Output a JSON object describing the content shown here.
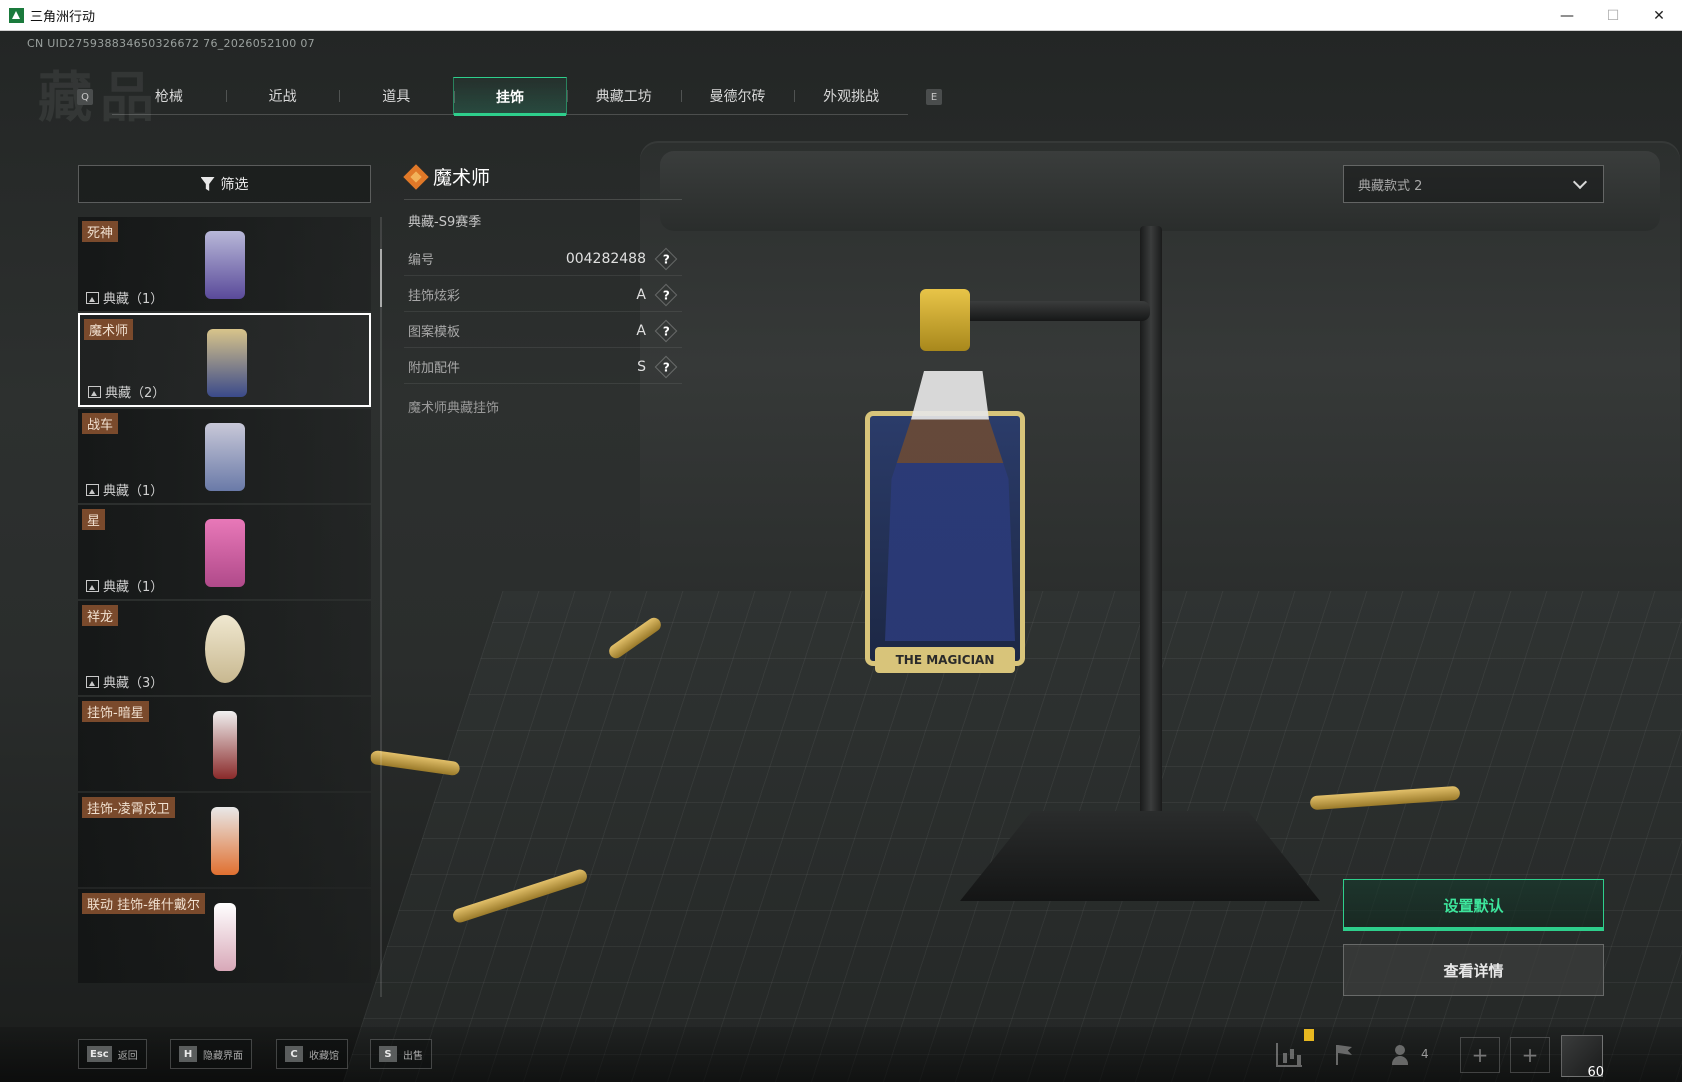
{
  "window": {
    "title": "三角洲行动",
    "controls": [
      "—",
      "☐",
      "✕"
    ]
  },
  "uid": "CN UID275938834650326672 76_2026052100 07",
  "watermark": "藏品",
  "tabs": {
    "left_key": "Q",
    "right_key": "E",
    "items": [
      {
        "label": "枪械",
        "active": false
      },
      {
        "label": "近战",
        "active": false
      },
      {
        "label": "道具",
        "active": false
      },
      {
        "label": "挂饰",
        "active": true
      },
      {
        "label": "典藏工坊",
        "active": false
      },
      {
        "label": "曼德尔砖",
        "active": false
      },
      {
        "label": "外观挑战",
        "active": false
      }
    ]
  },
  "filter": {
    "label": "筛选"
  },
  "list": {
    "items": [
      {
        "name": "死神",
        "count": "典藏（1）",
        "thumb_color": "#5a4a9a"
      },
      {
        "name": "魔术师",
        "count": "典藏（2）",
        "thumb_color": "#3a4a8a",
        "selected": true
      },
      {
        "name": "战车",
        "count": "典藏（1）",
        "thumb_color": "#6a7aa8"
      },
      {
        "name": "星",
        "count": "典藏（1）",
        "thumb_color": "#b04a8a"
      },
      {
        "name": "祥龙",
        "count": "典藏（3）",
        "thumb_color": "#c8b890"
      },
      {
        "name": "挂饰-暗星",
        "count": "",
        "thumb_color": "#d8d8d8"
      },
      {
        "name": "挂饰-凌霄戍卫",
        "count": "",
        "thumb_color": "#e07030"
      },
      {
        "name": "联动 挂饰-维什戴尔",
        "count": "",
        "thumb_color": "#d8a8b8"
      }
    ]
  },
  "detail": {
    "name": "魔术师",
    "season": "典藏-S9赛季",
    "attributes": [
      {
        "label": "编号",
        "value": "004282488"
      },
      {
        "label": "挂饰炫彩",
        "value": "A"
      },
      {
        "label": "图案模板",
        "value": "A"
      },
      {
        "label": "附加配件",
        "value": "S"
      }
    ],
    "help_glyph": "?",
    "description": "魔术师典藏挂饰",
    "plate_text": "THE MAGICIAN"
  },
  "style_select": {
    "value": "典藏款式 2"
  },
  "actions": {
    "set_default": "设置默认",
    "view_details": "查看详情"
  },
  "hints": [
    {
      "key": "Esc",
      "label": "返回"
    },
    {
      "key": "H",
      "label": "隐藏界面"
    },
    {
      "key": "C",
      "label": "收藏馆"
    },
    {
      "key": "S",
      "label": "出售"
    }
  ],
  "status": {
    "team_count": "4",
    "slot_glyph": "+",
    "level": "60"
  },
  "colors": {
    "accent": "#2ecf8c",
    "name_tag": "#7a4a2c",
    "title_icon": "#e07828"
  }
}
